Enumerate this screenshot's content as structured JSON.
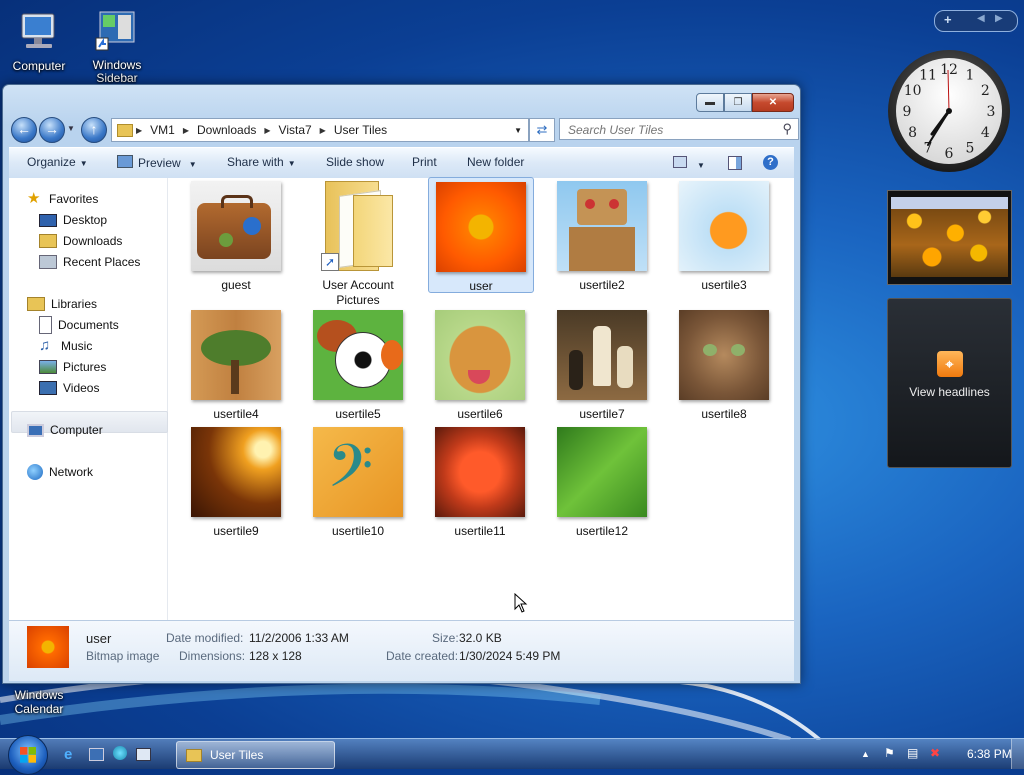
{
  "desktop": {
    "icons": [
      {
        "label": "Computer"
      },
      {
        "label": "Windows Sidebar"
      },
      {
        "label": "Windows Calendar"
      }
    ]
  },
  "window": {
    "address": [
      "VM1",
      "Downloads",
      "Vista7",
      "User Tiles"
    ],
    "search_placeholder": "Search User Tiles",
    "commands": {
      "organize": "Organize",
      "preview": "Preview",
      "share_with": "Share with",
      "slide_show": "Slide show",
      "print": "Print",
      "new_folder": "New folder"
    },
    "nav": {
      "favorites": "Favorites",
      "desktop": "Desktop",
      "downloads": "Downloads",
      "recent_places": "Recent Places",
      "libraries": "Libraries",
      "documents": "Documents",
      "music": "Music",
      "pictures": "Pictures",
      "videos": "Videos",
      "computer": "Computer",
      "network": "Network"
    },
    "files": [
      {
        "name": "guest"
      },
      {
        "name": "User Account Pictures"
      },
      {
        "name": "user"
      },
      {
        "name": "usertile2"
      },
      {
        "name": "usertile3"
      },
      {
        "name": "usertile4"
      },
      {
        "name": "usertile5"
      },
      {
        "name": "usertile6"
      },
      {
        "name": "usertile7"
      },
      {
        "name": "usertile8"
      },
      {
        "name": "usertile9"
      },
      {
        "name": "usertile10"
      },
      {
        "name": "usertile11"
      },
      {
        "name": "usertile12"
      }
    ],
    "selected_file": "user",
    "details": {
      "name": "user",
      "type": "Bitmap image",
      "date_modified_label": "Date modified:",
      "date_modified": "11/2/2006 1:33 AM",
      "dimensions_label": "Dimensions:",
      "dimensions": "128 x 128",
      "size_label": "Size:",
      "size": "32.0 KB",
      "date_created_label": "Date created:",
      "date_created": "1/30/2024 5:49 PM"
    }
  },
  "gadgets": {
    "feed_label": "View headlines",
    "clock_numbers": [
      "12",
      "1",
      "2",
      "3",
      "4",
      "5",
      "6",
      "7",
      "8",
      "9",
      "10",
      "11"
    ]
  },
  "taskbar": {
    "task_label": "User Tiles",
    "time": "6:38 PM"
  }
}
